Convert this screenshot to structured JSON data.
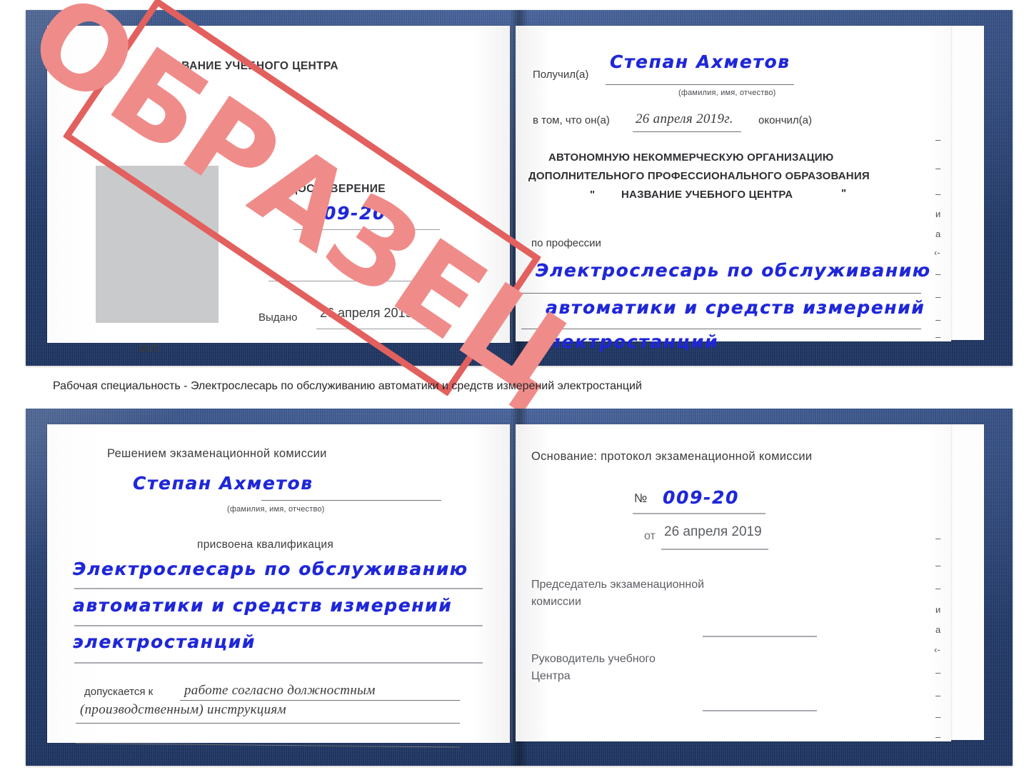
{
  "document": {
    "type": "certificate-book",
    "watermark": {
      "text": "ОБРАЗЕЦ",
      "color": "#e2605e"
    },
    "cover_color": "#27488a",
    "ink_color": "#1f27d8"
  },
  "caption": {
    "text": "Рабочая специальность - Электрослесарь по обслуживанию автоматики и средств измерений электростанций"
  },
  "cert_top": {
    "left_page": {
      "center_name": "НАЗВАНИЕ УЧЕБНОГО ЦЕНТРА",
      "title": "УДОСТОВЕРЕНИЕ",
      "number_label": "№",
      "number_value": "009-20",
      "issued_label": "Выдано",
      "issued_value": "26 апреля 2019",
      "seal_label": "М.П."
    },
    "right_page": {
      "received_label": "Получил(а)",
      "received_value": "Степан Ахметов",
      "fio_hint": "(фамилия, имя, отчество)",
      "in_that_label": "в том, что он(а)",
      "completion_date": "26 апреля 2019г.",
      "finished_label": "окончил(а)",
      "org_line1": "АВТОНОМНУЮ НЕКОММЕРЧЕСКУЮ ОРГАНИЗАЦИЮ",
      "org_line2": "ДОПОЛНИТЕЛЬНОГО ПРОФЕССИОНАЛЬНОГО ОБРАЗОВАНИЯ",
      "org_quote_open": "\"",
      "org_line3": "НАЗВАНИЕ УЧЕБНОГО ЦЕНТРА",
      "org_quote_close": "\"",
      "profession_label": "по профессии",
      "profession_line1": "Электрослесарь по обслуживанию",
      "profession_line2": "автоматики и средств измерений",
      "profession_line3": "электростанций",
      "margin_fragments": [
        "–",
        "–",
        "–",
        "и",
        "а",
        "‹-",
        "–",
        "–",
        "–",
        "–"
      ]
    }
  },
  "cert_bottom": {
    "left_page": {
      "heading": "Решением экзаменационной комиссии",
      "name_value": "Степан Ахметов",
      "fio_hint": "(фамилия, имя, отчество)",
      "qualification_label": "присвоена квалификация",
      "qualification_line1": "Электрослесарь по обслуживанию",
      "qualification_line2": "автоматики и средств измерений",
      "qualification_line3": "электростанций",
      "allowed_label": "допускается к",
      "allowed_line1": "работе согласно должностным",
      "allowed_line2": "(производственным) инструкциям"
    },
    "right_page": {
      "basis_label": "Основание: протокол экзаменационной комиссии",
      "protocol_number_label": "№",
      "protocol_number_value": "009-20",
      "protocol_date_label": "от",
      "protocol_date_value": "26 апреля 2019",
      "chairman_line1": "Председатель экзаменационной",
      "chairman_line2": "комиссии",
      "head_line1": "Руководитель учебного",
      "head_line2": "Центра",
      "margin_fragments": [
        "–",
        "–",
        "–",
        "и",
        "а",
        "‹-",
        "–",
        "–",
        "–",
        "–"
      ]
    }
  }
}
